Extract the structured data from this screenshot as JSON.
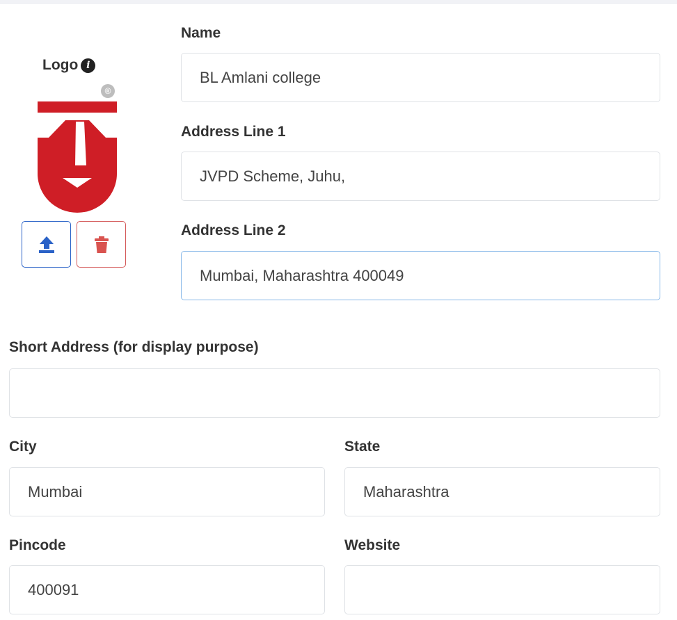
{
  "logo": {
    "label": "Logo",
    "info_icon": "info-circle-icon",
    "registered_mark": "®",
    "brand_color": "#cf1e26",
    "upload_icon": "upload-icon",
    "delete_icon": "trash-icon",
    "upload_color": "#2a62c7",
    "delete_color": "#d45a5a"
  },
  "form": {
    "name": {
      "label": "Name",
      "value": "BL Amlani college"
    },
    "address_line_1": {
      "label": "Address Line 1",
      "value": "JVPD Scheme, Juhu,"
    },
    "address_line_2": {
      "label": "Address Line 2",
      "value": "Mumbai, Maharashtra 400049"
    },
    "short_address": {
      "label": "Short Address (for display purpose)",
      "value": ""
    },
    "city": {
      "label": "City",
      "value": "Mumbai"
    },
    "state": {
      "label": "State",
      "value": "Maharashtra"
    },
    "pincode": {
      "label": "Pincode",
      "value": "400091"
    },
    "website": {
      "label": "Website",
      "value": ""
    }
  }
}
